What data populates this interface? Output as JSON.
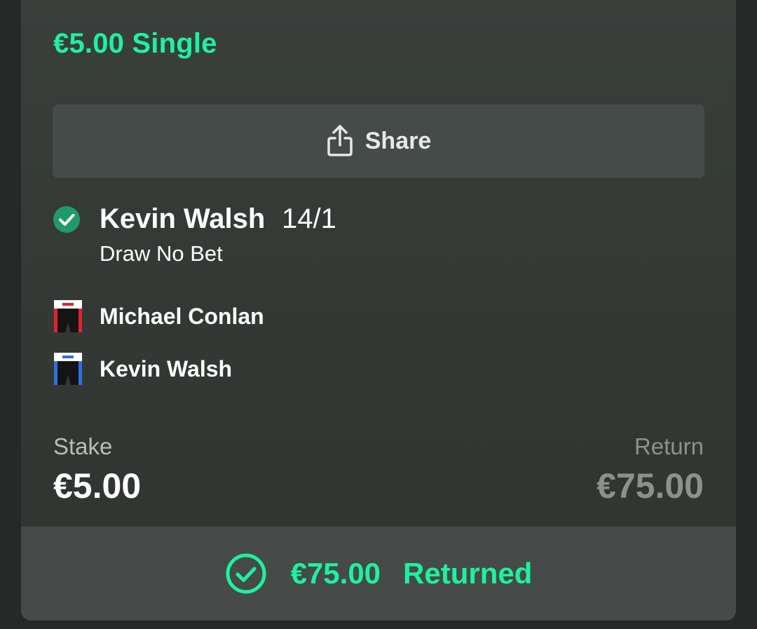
{
  "bet": {
    "title": "€5.00 Single"
  },
  "share": {
    "label": "Share",
    "icon": "share-icon"
  },
  "selection": {
    "name": "Kevin Walsh",
    "odds": "14/1",
    "market": "Draw No Bet",
    "status_icon": "check-circle-icon"
  },
  "participants": [
    {
      "name": "Michael Conlan",
      "icon": "red-boxing-shorts-icon",
      "trim_color": "#e0232a"
    },
    {
      "name": "Kevin Walsh",
      "icon": "blue-boxing-shorts-icon",
      "trim_color": "#2f6fe0"
    }
  ],
  "stake": {
    "label": "Stake",
    "value": "€5.00"
  },
  "return": {
    "label": "Return",
    "value": "€75.00"
  },
  "result": {
    "amount": "€75.00",
    "label": "Returned",
    "icon": "check-circle-outline-icon"
  },
  "colors": {
    "accent": "#1cf2a0",
    "check_green": "#1f9a6c"
  }
}
